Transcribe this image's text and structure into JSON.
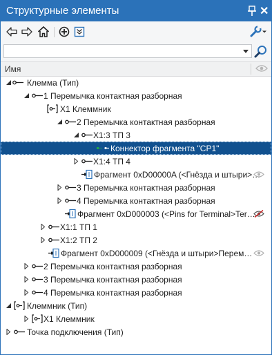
{
  "window": {
    "title": "Структурные элементы"
  },
  "search": {
    "value": "",
    "placeholder": ""
  },
  "columns": {
    "name": "Имя"
  },
  "colors": {
    "title_bar": "#2b72b9",
    "selection": "#11518f",
    "link_green": "#22aa44"
  },
  "tree": [
    {
      "label": "Клемма (Тип)",
      "expander": "expanded",
      "icon": "wire-icon"
    },
    {
      "label": "1 Перемычка контактная разборная",
      "expander": "expanded",
      "icon": "wire-icon"
    },
    {
      "label": "X1 Клеммник",
      "expander": "none",
      "icon": "terminal-block-icon"
    },
    {
      "label": "2 Перемычка контактная разборная",
      "expander": "expanded",
      "icon": "wire-icon"
    },
    {
      "label": "X1:3 ТП 3",
      "expander": "expanded",
      "icon": "wire-icon"
    },
    {
      "label": "Коннектор фрагмента \"CP1\"",
      "expander": "none",
      "icon": "connector-icon",
      "selected": true
    },
    {
      "label": "X1:4 ТП 4",
      "expander": "collapsed",
      "icon": "wire-icon"
    },
    {
      "label": "Фрагмент 0xD00000A (<Гнёзда и штыри>…",
      "expander": "none",
      "icon": "fragment-icon",
      "eye": "visible"
    },
    {
      "label": "3 Перемычка контактная разборная",
      "expander": "collapsed",
      "icon": "wire-icon"
    },
    {
      "label": "4 Перемычка контактная разборная",
      "expander": "collapsed",
      "icon": "wire-icon"
    },
    {
      "label": "Фрагмент 0xD000003 (<Pins for Terminal>Ter…",
      "expander": "none",
      "icon": "fragment-icon",
      "eye": "hidden"
    },
    {
      "label": "X1:1 ТП 1",
      "expander": "collapsed",
      "icon": "wire-icon"
    },
    {
      "label": "X1:2 ТП 2",
      "expander": "collapsed",
      "icon": "wire-icon"
    },
    {
      "label": "Фрагмент 0xD000009 (<Гнёзда и штыри>Перем…",
      "expander": "none",
      "icon": "fragment-icon",
      "eye": "visible"
    },
    {
      "label": "2 Перемычка контактная разборная",
      "expander": "collapsed",
      "icon": "wire-icon"
    },
    {
      "label": "3 Перемычка контактная разборная",
      "expander": "collapsed",
      "icon": "wire-icon"
    },
    {
      "label": "4 Перемычка контактная разборная",
      "expander": "collapsed",
      "icon": "wire-icon"
    },
    {
      "label": "Клеммник (Тип)",
      "expander": "expanded",
      "icon": "terminal-block-icon"
    },
    {
      "label": "X1 Клеммник",
      "expander": "collapsed",
      "icon": "terminal-block-icon"
    },
    {
      "label": "Точка подключения (Тип)",
      "expander": "collapsed",
      "icon": "wire-icon"
    }
  ]
}
